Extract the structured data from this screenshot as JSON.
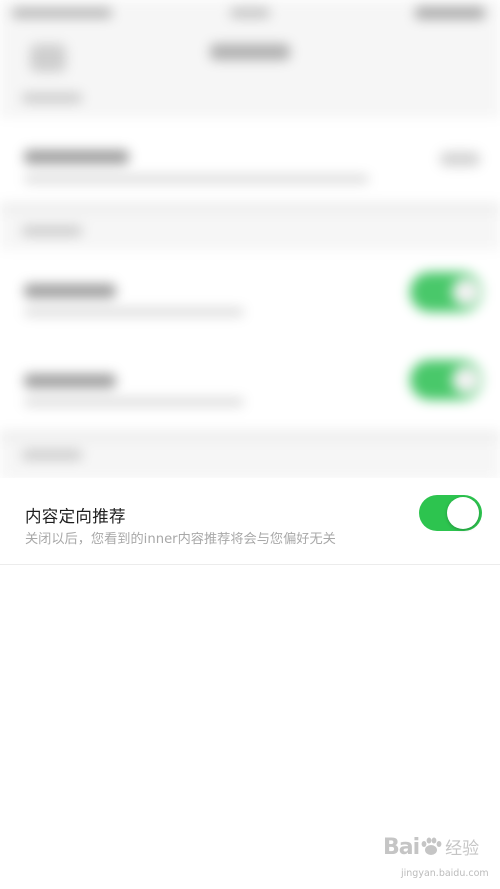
{
  "setting": {
    "title": "内容定向推荐",
    "description": "关闭以后，您看到的inner内容推荐将会与您偏好无关",
    "toggle_on": true
  },
  "colors": {
    "toggle_on": "#2dc44f",
    "title_text": "#1e1e1e",
    "description_text": "#a8a8a8"
  },
  "watermark": {
    "logo_text": "Bai  经验",
    "url": "jingyan.baidu.com"
  },
  "icons": [
    "back-icon",
    "chevron-right-icon",
    "paw-icon"
  ]
}
